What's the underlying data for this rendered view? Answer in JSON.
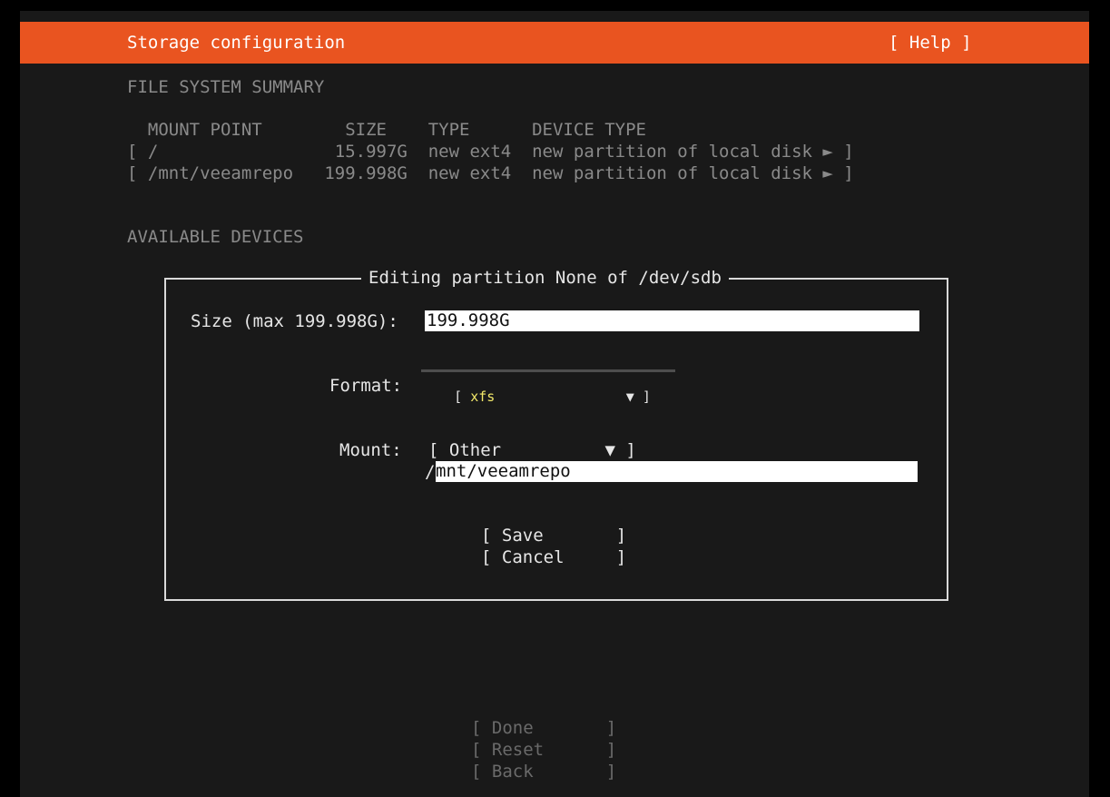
{
  "header": {
    "title": "Storage configuration",
    "help": "[ Help ]"
  },
  "fs_summary": {
    "heading": "FILE SYSTEM SUMMARY",
    "columns": "  MOUNT POINT        SIZE    TYPE      DEVICE TYPE",
    "rows": [
      "[ /                 15.997G  new ext4  new partition of local disk ► ]",
      "[ /mnt/veeamrepo   199.998G  new ext4  new partition of local disk ► ]"
    ]
  },
  "available_devices": {
    "heading": "AVAILABLE DEVICES"
  },
  "dialog": {
    "title": "Editing partition None of /dev/sdb",
    "size_label": "Size (max 199.998G):",
    "size_value": "199.998G",
    "format_label": "Format:",
    "format_open": "[ ",
    "format_value": "xfs",
    "format_close": "                ▼ ]",
    "mount_label": "Mount:",
    "mount_select": "[ Other          ▼ ]",
    "mount_prefix": "/",
    "mount_value": "mnt/veeamrepo",
    "save": "[ Save       ]",
    "cancel": "[ Cancel     ]"
  },
  "footer": {
    "done": "[ Done       ]",
    "reset": "[ Reset      ]",
    "back": "[ Back       ]"
  },
  "colors": {
    "header": "#e95420",
    "background": "#191919",
    "format_value": "#f2e86a"
  }
}
